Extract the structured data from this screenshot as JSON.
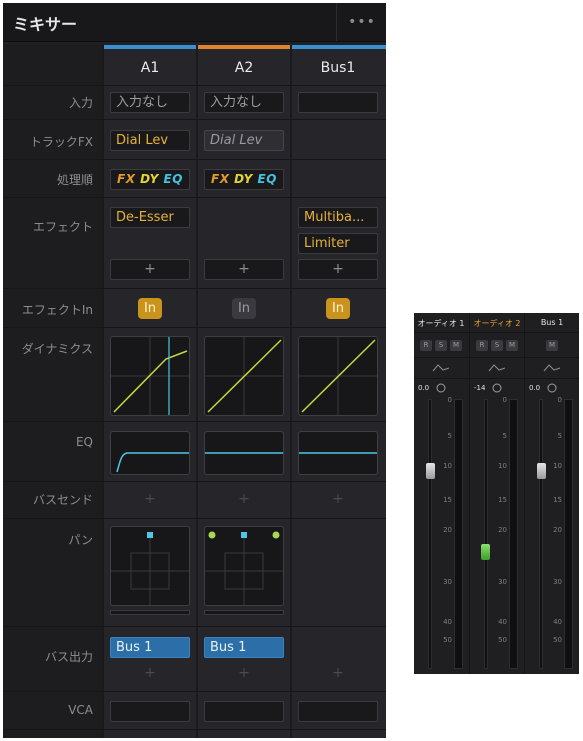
{
  "panel": {
    "title": "ミキサー",
    "more_label": "•••"
  },
  "channels": [
    {
      "name": "A1",
      "color": "#3a8fd0",
      "input": "入力なし",
      "track_fx": "Dial Lev",
      "track_fx_bypassed": false,
      "effects": [
        "De-Esser"
      ],
      "effect_in": "In",
      "effect_in_on": true,
      "bus_out": "Bus 1"
    },
    {
      "name": "A2",
      "color": "#e1832c",
      "input": "入力なし",
      "track_fx": "Dial Lev",
      "track_fx_bypassed": true,
      "effects": [],
      "effect_in": "In",
      "effect_in_on": false,
      "bus_out": "Bus 1"
    },
    {
      "name": "Bus1",
      "color": "#3a8fd0",
      "input": "",
      "track_fx": "",
      "effects": [
        "Multiba...",
        "Limiter"
      ],
      "effect_in": "In",
      "effect_in_on": true,
      "bus_out": ""
    }
  ],
  "rows": {
    "input": "入力",
    "track_fx": "トラックFX",
    "order": "処理順",
    "effects": "エフェクト",
    "effect_in": "エフェクトIn",
    "dynamics": "ダイナミクス",
    "eq": "EQ",
    "bus_send": "バスセンド",
    "pan": "パン",
    "bus_out": "バス出力",
    "vca": "VCA"
  },
  "order_labels": {
    "fx": "FX",
    "dy": "DY",
    "eq": "EQ"
  },
  "add_symbol": "+",
  "mini_mixer": {
    "channels": [
      {
        "name": "オーディオ 1",
        "selected": false,
        "buttons": [
          "R",
          "S",
          "M"
        ],
        "value": "0.0"
      },
      {
        "name": "オーディオ 2",
        "selected": true,
        "buttons": [
          "R",
          "S",
          "M"
        ],
        "value": "-14"
      },
      {
        "name": "Bus 1",
        "selected": false,
        "buttons": [
          "M"
        ],
        "value": "0.0"
      }
    ],
    "scale": [
      "0",
      "5",
      "10",
      "15",
      "20",
      "30",
      "40",
      "50"
    ]
  },
  "colors": {
    "accent": "#e5a52c",
    "bus_blue": "#2c6fa8",
    "curve_yellow": "#c7d83a",
    "curve_cyan": "#4fc6e6"
  }
}
